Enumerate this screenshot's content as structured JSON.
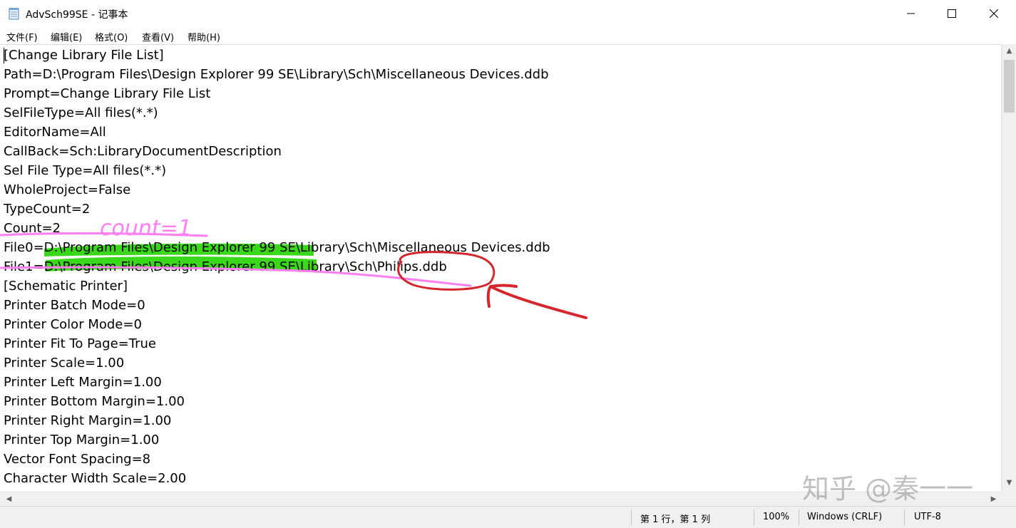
{
  "window": {
    "title": "AdvSch99SE - 记事本",
    "icon": "notepad-icon",
    "controls": [
      "minimize-icon",
      "maximize-icon",
      "close-icon"
    ]
  },
  "menu": [
    {
      "label": "文件(F)"
    },
    {
      "label": "编辑(E)"
    },
    {
      "label": "格式(O)"
    },
    {
      "label": "查看(V)"
    },
    {
      "label": "帮助(H)"
    }
  ],
  "editor": {
    "lines": [
      "[Change Library File List]",
      "Path=D:\\Program Files\\Design Explorer 99 SE\\Library\\Sch\\Miscellaneous Devices.ddb",
      "Prompt=Change Library File List",
      "SelFileType=All files(*.*)",
      "EditorName=All",
      "CallBack=Sch:LibraryDocumentDescription",
      "Sel File Type=All files(*.*)",
      "WholeProject=False",
      "TypeCount=2",
      "Count=2",
      "File0=D:\\Program Files\\Design Explorer 99 SE\\Library\\Sch\\Miscellaneous Devices.ddb",
      "File1=D:\\Program Files\\Design Explorer 99 SE\\Library\\Sch\\Philips.ddb",
      "[Schematic Printer]",
      "Printer Batch Mode=0",
      "Printer Color Mode=0",
      "Printer Fit To Page=True",
      "Printer Scale=1.00",
      "Printer Left Margin=1.00",
      "Printer Bottom Margin=1.00",
      "Printer Right Margin=1.00",
      "Printer Top Margin=1.00",
      "Vector Font Spacing=8",
      "Character Width Scale=2.00"
    ]
  },
  "annotations": {
    "handwritten_note": "count=1",
    "highlight_color": "#2fd60e",
    "pen_pink": "#ff7ff0",
    "pen_red": "#d4262c"
  },
  "statusbar": {
    "position": "第 1 行，第 1 列",
    "zoom": "100%",
    "line_ending": "Windows (CRLF)",
    "encoding": "UTF-8"
  },
  "watermark": "知乎 @秦一一"
}
